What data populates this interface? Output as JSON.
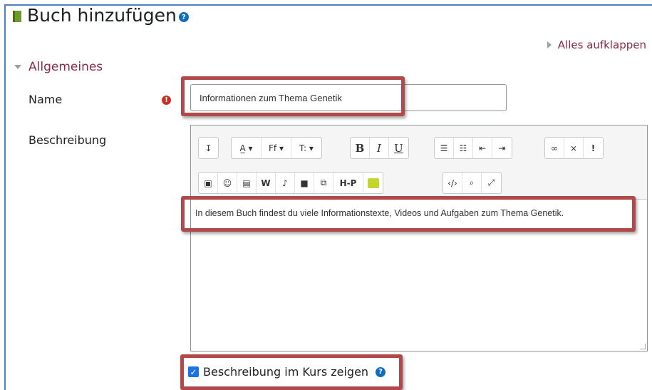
{
  "page": {
    "title": "Buch hinzufügen",
    "expand_all": "Alles aufklappen"
  },
  "section": {
    "title": "Allgemeines"
  },
  "form": {
    "name_label": "Name",
    "name_value": "Informationen zum Thema Genetik",
    "description_label": "Beschreibung",
    "description_value": "In diesem Buch findest du viele Informationstexte, Videos und Aufgaben zum Thema Genetik.",
    "show_description_label": "Beschreibung im Kurs zeigen",
    "show_description_checked": true
  },
  "toolbar": {
    "row1": [
      {
        "icon": "collapse-icon",
        "glyph": "↧"
      },
      {
        "icon": "font-color-icon",
        "glyph": "A̲▾"
      },
      {
        "icon": "font-family-icon",
        "glyph": "Ff ▾"
      },
      {
        "icon": "font-size-icon",
        "glyph": "T: ▾"
      },
      {
        "icon": "bold-icon",
        "glyph": "B"
      },
      {
        "icon": "italic-icon",
        "glyph": "I"
      },
      {
        "icon": "underline-icon",
        "glyph": "U"
      },
      {
        "icon": "unordered-list-icon",
        "glyph": "☰"
      },
      {
        "icon": "ordered-list-icon",
        "glyph": "☷"
      },
      {
        "icon": "outdent-icon",
        "glyph": "⇤"
      },
      {
        "icon": "indent-icon",
        "glyph": "⇥"
      },
      {
        "icon": "link-icon",
        "glyph": "🔗"
      },
      {
        "icon": "unlink-icon",
        "glyph": "⛓"
      },
      {
        "icon": "accessibility-icon",
        "glyph": "!"
      }
    ],
    "row2": [
      {
        "icon": "image-icon",
        "glyph": "▣"
      },
      {
        "icon": "emoji-icon",
        "glyph": "☺"
      },
      {
        "icon": "file-icon",
        "glyph": "▤"
      },
      {
        "icon": "word-import-icon",
        "glyph": "W"
      },
      {
        "icon": "microphone-icon",
        "glyph": "🎙"
      },
      {
        "icon": "video-icon",
        "glyph": "■"
      },
      {
        "icon": "copy-icon",
        "glyph": "⧉"
      },
      {
        "icon": "h5p-icon",
        "glyph": "H-P"
      },
      {
        "icon": "media-icon",
        "glyph": "▬"
      },
      {
        "icon": "html-icon",
        "glyph": "</>"
      },
      {
        "icon": "search-icon",
        "glyph": "⌕"
      },
      {
        "icon": "fullscreen-icon",
        "glyph": "⤢"
      }
    ]
  },
  "colors": {
    "accent": "#8a2b47",
    "highlight": "#b04a4a",
    "help": "#0f6cbf",
    "required": "#ca3120"
  }
}
